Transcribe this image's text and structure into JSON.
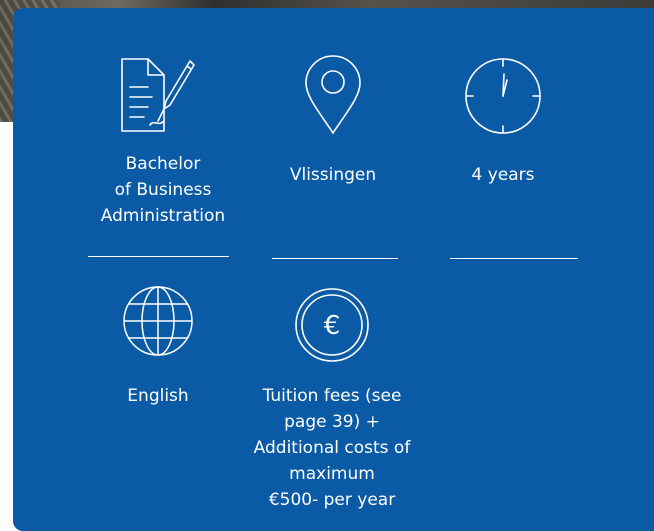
{
  "colors": {
    "panel": "#0b5aa5",
    "foreground": "#ffffff"
  },
  "items": [
    {
      "icon": "document-pen-icon",
      "label_lines": [
        "Bachelor",
        "of Business",
        "Administration"
      ]
    },
    {
      "icon": "location-pin-icon",
      "label_lines": [
        "Vlissingen"
      ]
    },
    {
      "icon": "clock-icon",
      "label_lines": [
        "4 years"
      ]
    },
    {
      "icon": "globe-icon",
      "label_lines": [
        "English"
      ]
    },
    {
      "icon": "euro-coin-icon",
      "label_lines": [
        "Tuition fees (see",
        "page 39) +",
        "Additional costs of",
        "maximum",
        "€500- per year"
      ]
    }
  ]
}
